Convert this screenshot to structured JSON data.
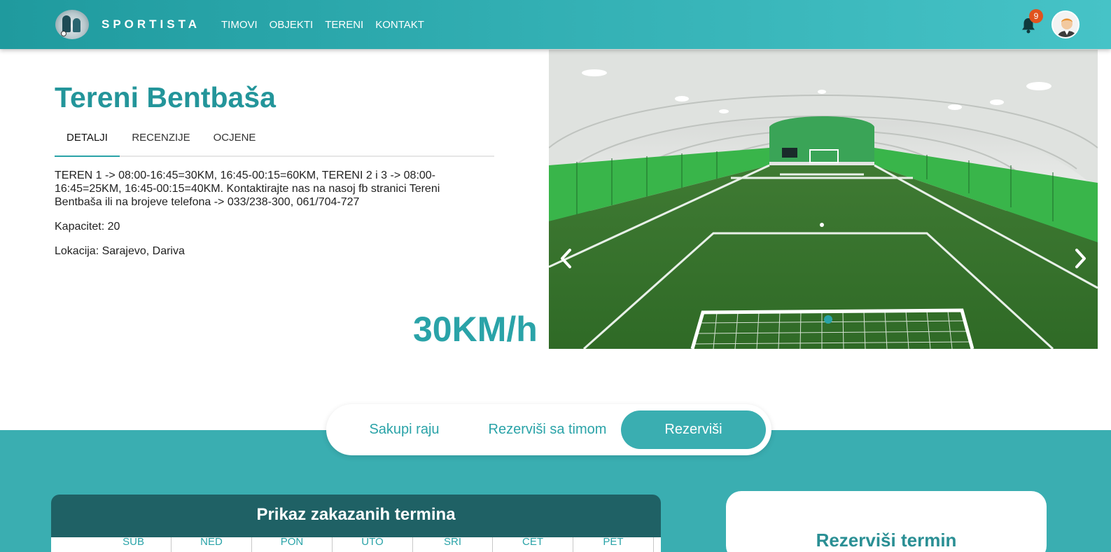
{
  "navbar": {
    "brand": "SPORTISTA",
    "links": [
      {
        "label": "TIMOVI"
      },
      {
        "label": "OBJEKTI"
      },
      {
        "label": "TERENI"
      },
      {
        "label": "KONTAKT"
      }
    ],
    "notification_count": "9",
    "icons": {
      "bell": "bell-icon",
      "avatar": "user-avatar"
    }
  },
  "venue": {
    "title": "Tereni Bentbaša",
    "tabs": [
      {
        "label": "DETALJI",
        "active": true
      },
      {
        "label": "RECENZIJE",
        "active": false
      },
      {
        "label": "OCJENE",
        "active": false
      }
    ],
    "description": "TEREN 1 -> 08:00-16:45=30KM, 16:45-00:15=60KM, TERENI 2 i 3 -> 08:00-16:45=25KM, 16:45-00:15=40KM. Kontaktirajte nas na nasoj fb stranici Tereni Bentbaša ili na brojeve telefona -> 033/238-300, 061/704-727",
    "capacity": "Kapacitet: 20",
    "location": "Lokacija: Sarajevo, Dariva",
    "price": "30KM/h"
  },
  "carousel": {
    "icons": {
      "prev": "chevron-left-icon",
      "next": "chevron-right-icon"
    },
    "active_slide": 1
  },
  "actions": {
    "options": [
      {
        "label": "Sakupi raju",
        "active": false
      },
      {
        "label": "Rezerviši sa timom",
        "active": false
      },
      {
        "label": "Rezerviši",
        "active": true
      }
    ]
  },
  "schedule": {
    "title": "Prikaz zakazanih termina",
    "days": [
      "SUB",
      "NED",
      "PON",
      "UTO",
      "SRI",
      "CET",
      "PET"
    ]
  },
  "reserve": {
    "title": "Rezerviši termin"
  },
  "colors": {
    "accent": "#2aa3a8",
    "teal_section": "#3aaeb1",
    "schedule_header": "#1f6165",
    "badge": "#e0531f"
  }
}
